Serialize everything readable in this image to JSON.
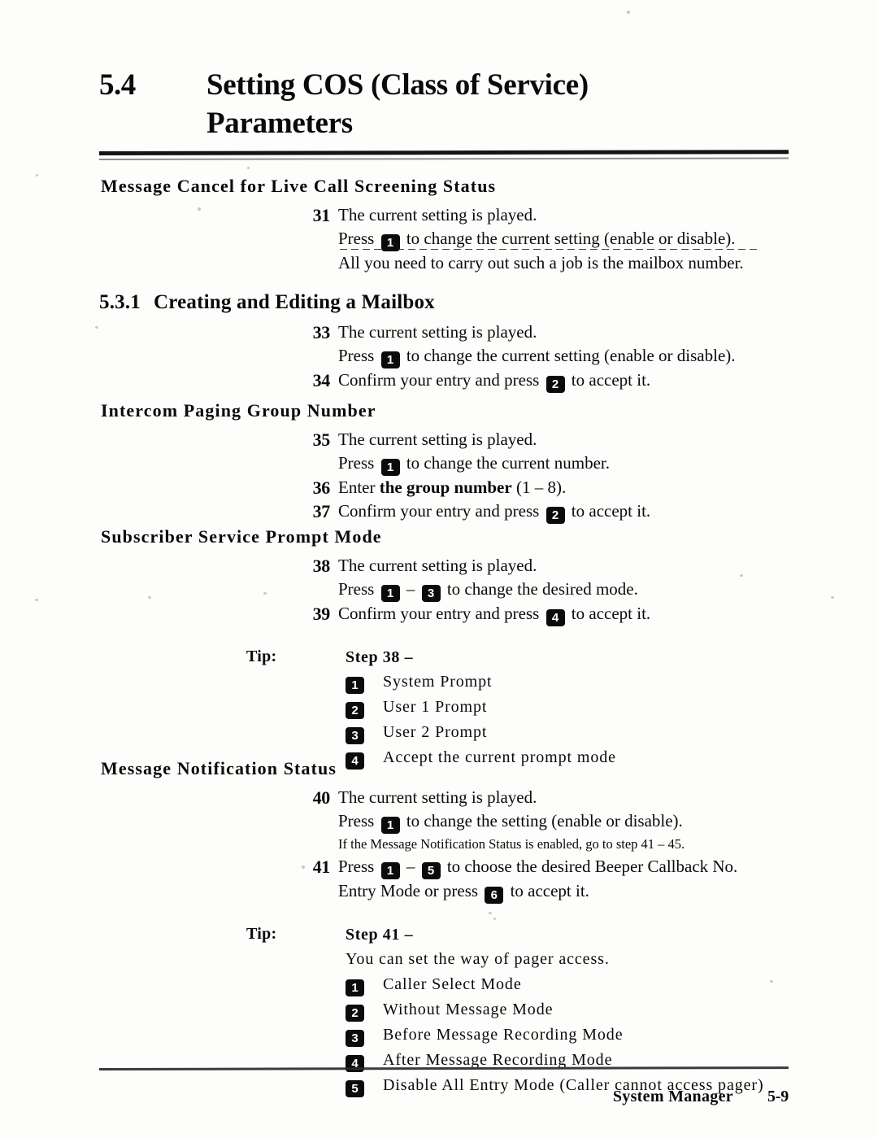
{
  "title": {
    "number": "5.4",
    "line1": "Setting COS (Class of Service)",
    "line2": "Parameters"
  },
  "sections": [
    {
      "heading": "Message Cancel for Live Call Screening Status",
      "steps": [
        {
          "num": "31",
          "lines": [
            {
              "pre": "The current setting is played.",
              "key": "",
              "post": ""
            },
            {
              "pre": "Press ",
              "key": "1",
              "post": " to change the current setting (enable or disable)."
            }
          ]
        }
      ],
      "continuation": "All you need to carry out such a job is the mailbox number."
    },
    {
      "subnumber": "5.3.1",
      "heading": "Creating and Editing a Mailbox",
      "steps": [
        {
          "num": "33",
          "lines": [
            {
              "pre": "The current setting is played.",
              "key": "",
              "post": ""
            },
            {
              "pre": "Press ",
              "key": "1",
              "post": " to change the current setting (enable or disable)."
            }
          ]
        },
        {
          "num": "34",
          "lines": [
            {
              "pre": "Confirm your entry and press ",
              "key": "2",
              "post": " to accept it."
            }
          ]
        }
      ]
    },
    {
      "heading": "Intercom Paging Group Number",
      "steps": [
        {
          "num": "35",
          "lines": [
            {
              "pre": "The current setting is played.",
              "key": "",
              "post": ""
            },
            {
              "pre": "Press ",
              "key": "1",
              "post": " to change the current number."
            }
          ]
        },
        {
          "num": "36",
          "lines": [
            {
              "pre": "Enter ",
              "bold": "the group number",
              "post": " (1 – 8)."
            }
          ]
        },
        {
          "num": "37",
          "lines": [
            {
              "pre": "Confirm your entry and press ",
              "key": "2",
              "post": " to accept it."
            }
          ]
        }
      ]
    },
    {
      "heading": "Subscriber Service Prompt Mode",
      "steps": [
        {
          "num": "38",
          "lines": [
            {
              "pre": "The current setting is played.",
              "key": "",
              "post": ""
            },
            {
              "pre": "Press ",
              "key": "1",
              "mid": " – ",
              "key2": "3",
              "post": " to change the desired mode."
            }
          ]
        },
        {
          "num": "39",
          "lines": [
            {
              "pre": "Confirm your entry and press ",
              "key": "4",
              "post": " to accept it."
            }
          ]
        }
      ],
      "tip": {
        "label": "Tip:",
        "step": "Step 38 –",
        "items": [
          {
            "key": "1",
            "label": "System  Prompt"
          },
          {
            "key": "2",
            "label": "User  1  Prompt"
          },
          {
            "key": "3",
            "label": "User  2  Prompt"
          },
          {
            "key": "4",
            "label": "Accept  the  current  prompt  mode"
          }
        ]
      }
    },
    {
      "heading": "Message Notification Status",
      "steps": [
        {
          "num": "40",
          "lines": [
            {
              "pre": "The current setting is played.",
              "key": "",
              "post": ""
            },
            {
              "pre": "Press ",
              "key": "1",
              "post": " to change the setting (enable or disable)."
            },
            {
              "pre": "If the Message Notification Status is enabled, go to step 41 – 45.",
              "small": true
            }
          ]
        },
        {
          "num": "41",
          "lines": [
            {
              "pre": "Press ",
              "key": "1",
              "mid": " – ",
              "key2": "5",
              "post": " to choose the desired Beeper Callback No."
            },
            {
              "pre": "Entry Mode or press ",
              "key": "6",
              "post": " to accept it."
            }
          ]
        }
      ],
      "tip": {
        "label": "Tip:",
        "step": "Step 41 –",
        "note": "You  can  set  the  way  of  pager  access.",
        "items": [
          {
            "key": "1",
            "label": "Caller  Select  Mode"
          },
          {
            "key": "2",
            "label": "Without  Message  Mode"
          },
          {
            "key": "3",
            "label": "Before  Message  Recording  Mode"
          },
          {
            "key": "4",
            "label": "After  Message  Recording  Mode"
          },
          {
            "key": "5",
            "label": "Disable  All  Entry  Mode  (Caller  cannot  access  pager)"
          }
        ]
      }
    }
  ],
  "footer": {
    "manual": "System Manager",
    "page": "5-9"
  }
}
